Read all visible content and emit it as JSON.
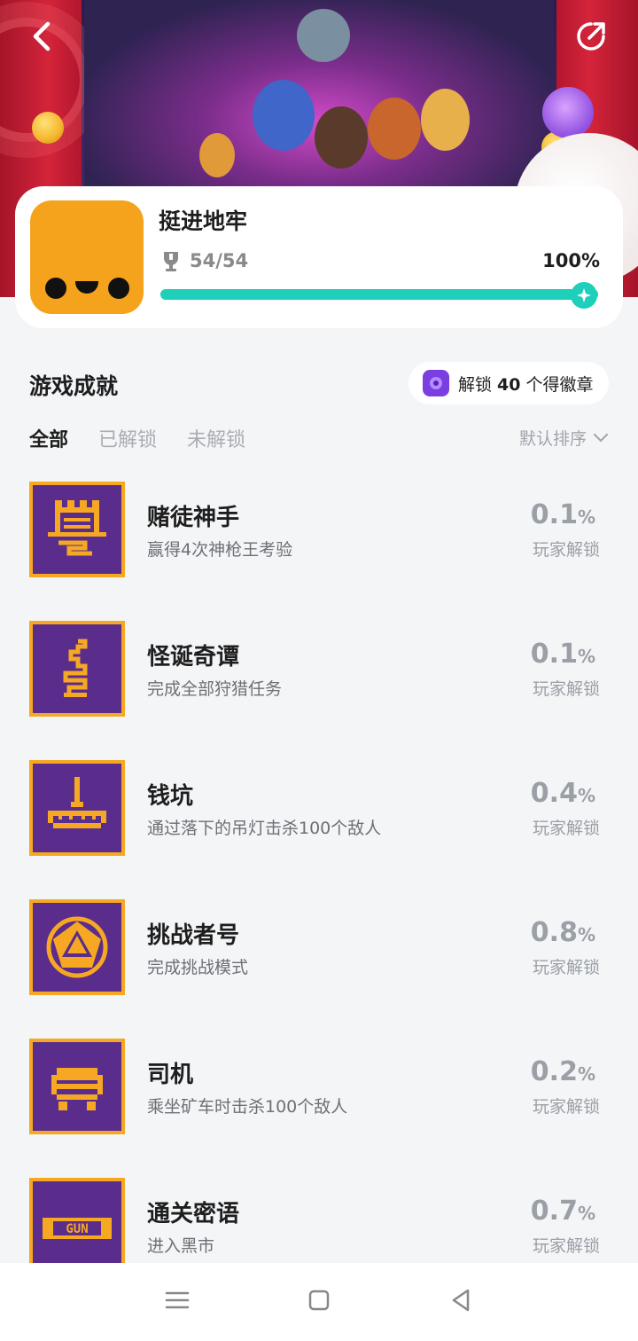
{
  "game": {
    "title": "挺进地牢",
    "trophy_count": "54/54",
    "completion": "100%",
    "progress": 1.0
  },
  "section": {
    "title": "游戏成就",
    "badge_prefix": "解锁 ",
    "badge_count": "40",
    "badge_suffix": " 个得徽章"
  },
  "tabs": [
    "全部",
    "已解锁",
    "未解锁"
  ],
  "sort_label": "默认排序",
  "achievements": [
    {
      "name": "赌徒神手",
      "desc": "赢得4次神枪王考验",
      "rate": "0.1",
      "unit": "%",
      "rate_label": "玩家解锁"
    },
    {
      "name": "怪诞奇谭",
      "desc": "完成全部狩猎任务",
      "rate": "0.1",
      "unit": "%",
      "rate_label": "玩家解锁"
    },
    {
      "name": "钱坑",
      "desc": "通过落下的吊灯击杀100个敌人",
      "rate": "0.4",
      "unit": "%",
      "rate_label": "玩家解锁"
    },
    {
      "name": "挑战者号",
      "desc": "完成挑战模式",
      "rate": "0.8",
      "unit": "%",
      "rate_label": "玩家解锁"
    },
    {
      "name": "司机",
      "desc": "乘坐矿车时击杀100个敌人",
      "rate": "0.2",
      "unit": "%",
      "rate_label": "玩家解锁"
    },
    {
      "name": "通关密语",
      "desc": "进入黑市",
      "rate": "0.7",
      "unit": "%",
      "rate_label": "玩家解锁",
      "icon_text": "GUN"
    }
  ],
  "colors": {
    "accent": "#1ecfb9",
    "achievement_frame": "#f7a822",
    "achievement_bg": "#5a2c8c"
  }
}
